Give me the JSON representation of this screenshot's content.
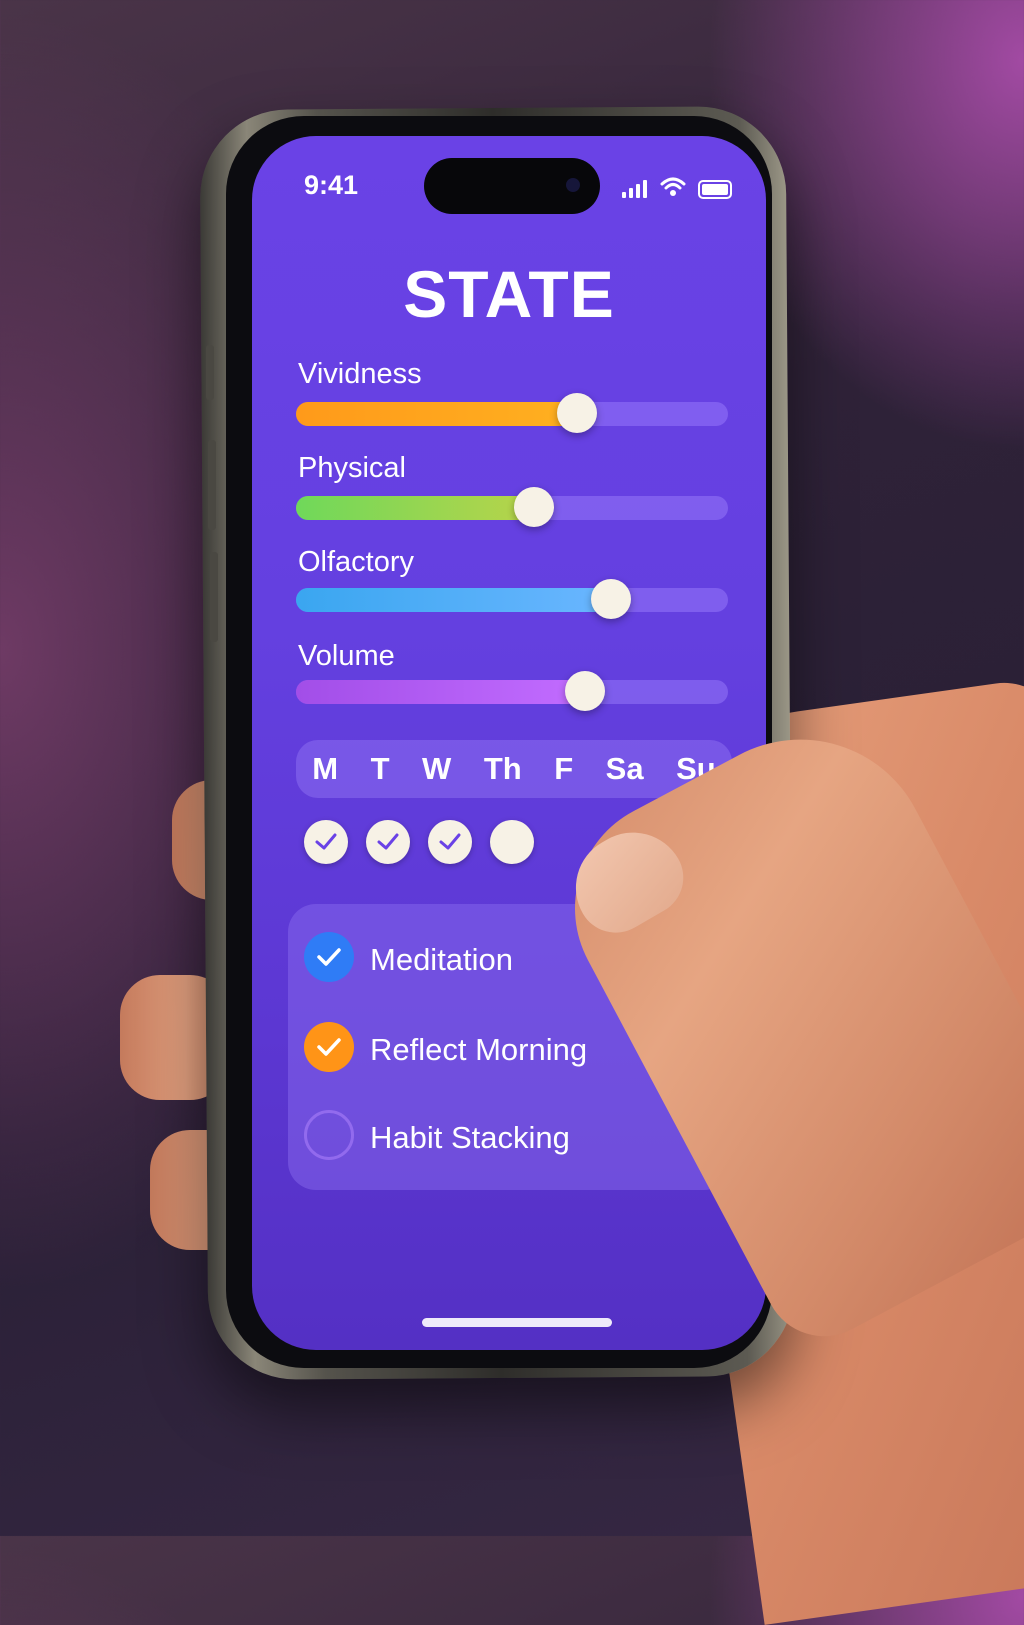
{
  "status_bar": {
    "time": "9:41",
    "icons": [
      "cellular-signal-icon",
      "wifi-icon",
      "battery-icon"
    ]
  },
  "app": {
    "title": "STATE"
  },
  "sliders": [
    {
      "label": "Vividness",
      "value": 0.65,
      "gradient": [
        "#ff9a1a",
        "#ffb020"
      ]
    },
    {
      "label": "Physical",
      "value": 0.55,
      "gradient": [
        "#6fd85a",
        "#b8d44a"
      ]
    },
    {
      "label": "Olfactory",
      "value": 0.73,
      "gradient": [
        "#3aa6f0",
        "#6ab6ff"
      ]
    },
    {
      "label": "Volume",
      "value": 0.67,
      "gradient": [
        "#a24ee8",
        "#c26cff"
      ]
    }
  ],
  "week": {
    "days": [
      "M",
      "T",
      "W",
      "Th",
      "F",
      "Sa",
      "Su"
    ],
    "completed": [
      true,
      true,
      true,
      false
    ]
  },
  "habits": [
    {
      "label": "Meditation",
      "checked": true,
      "color": "#2f7cf6"
    },
    {
      "label": "Reflect Morning",
      "checked": true,
      "color": "#ff9417"
    },
    {
      "label": "Habit Stacking",
      "checked": false,
      "color": ""
    }
  ]
}
